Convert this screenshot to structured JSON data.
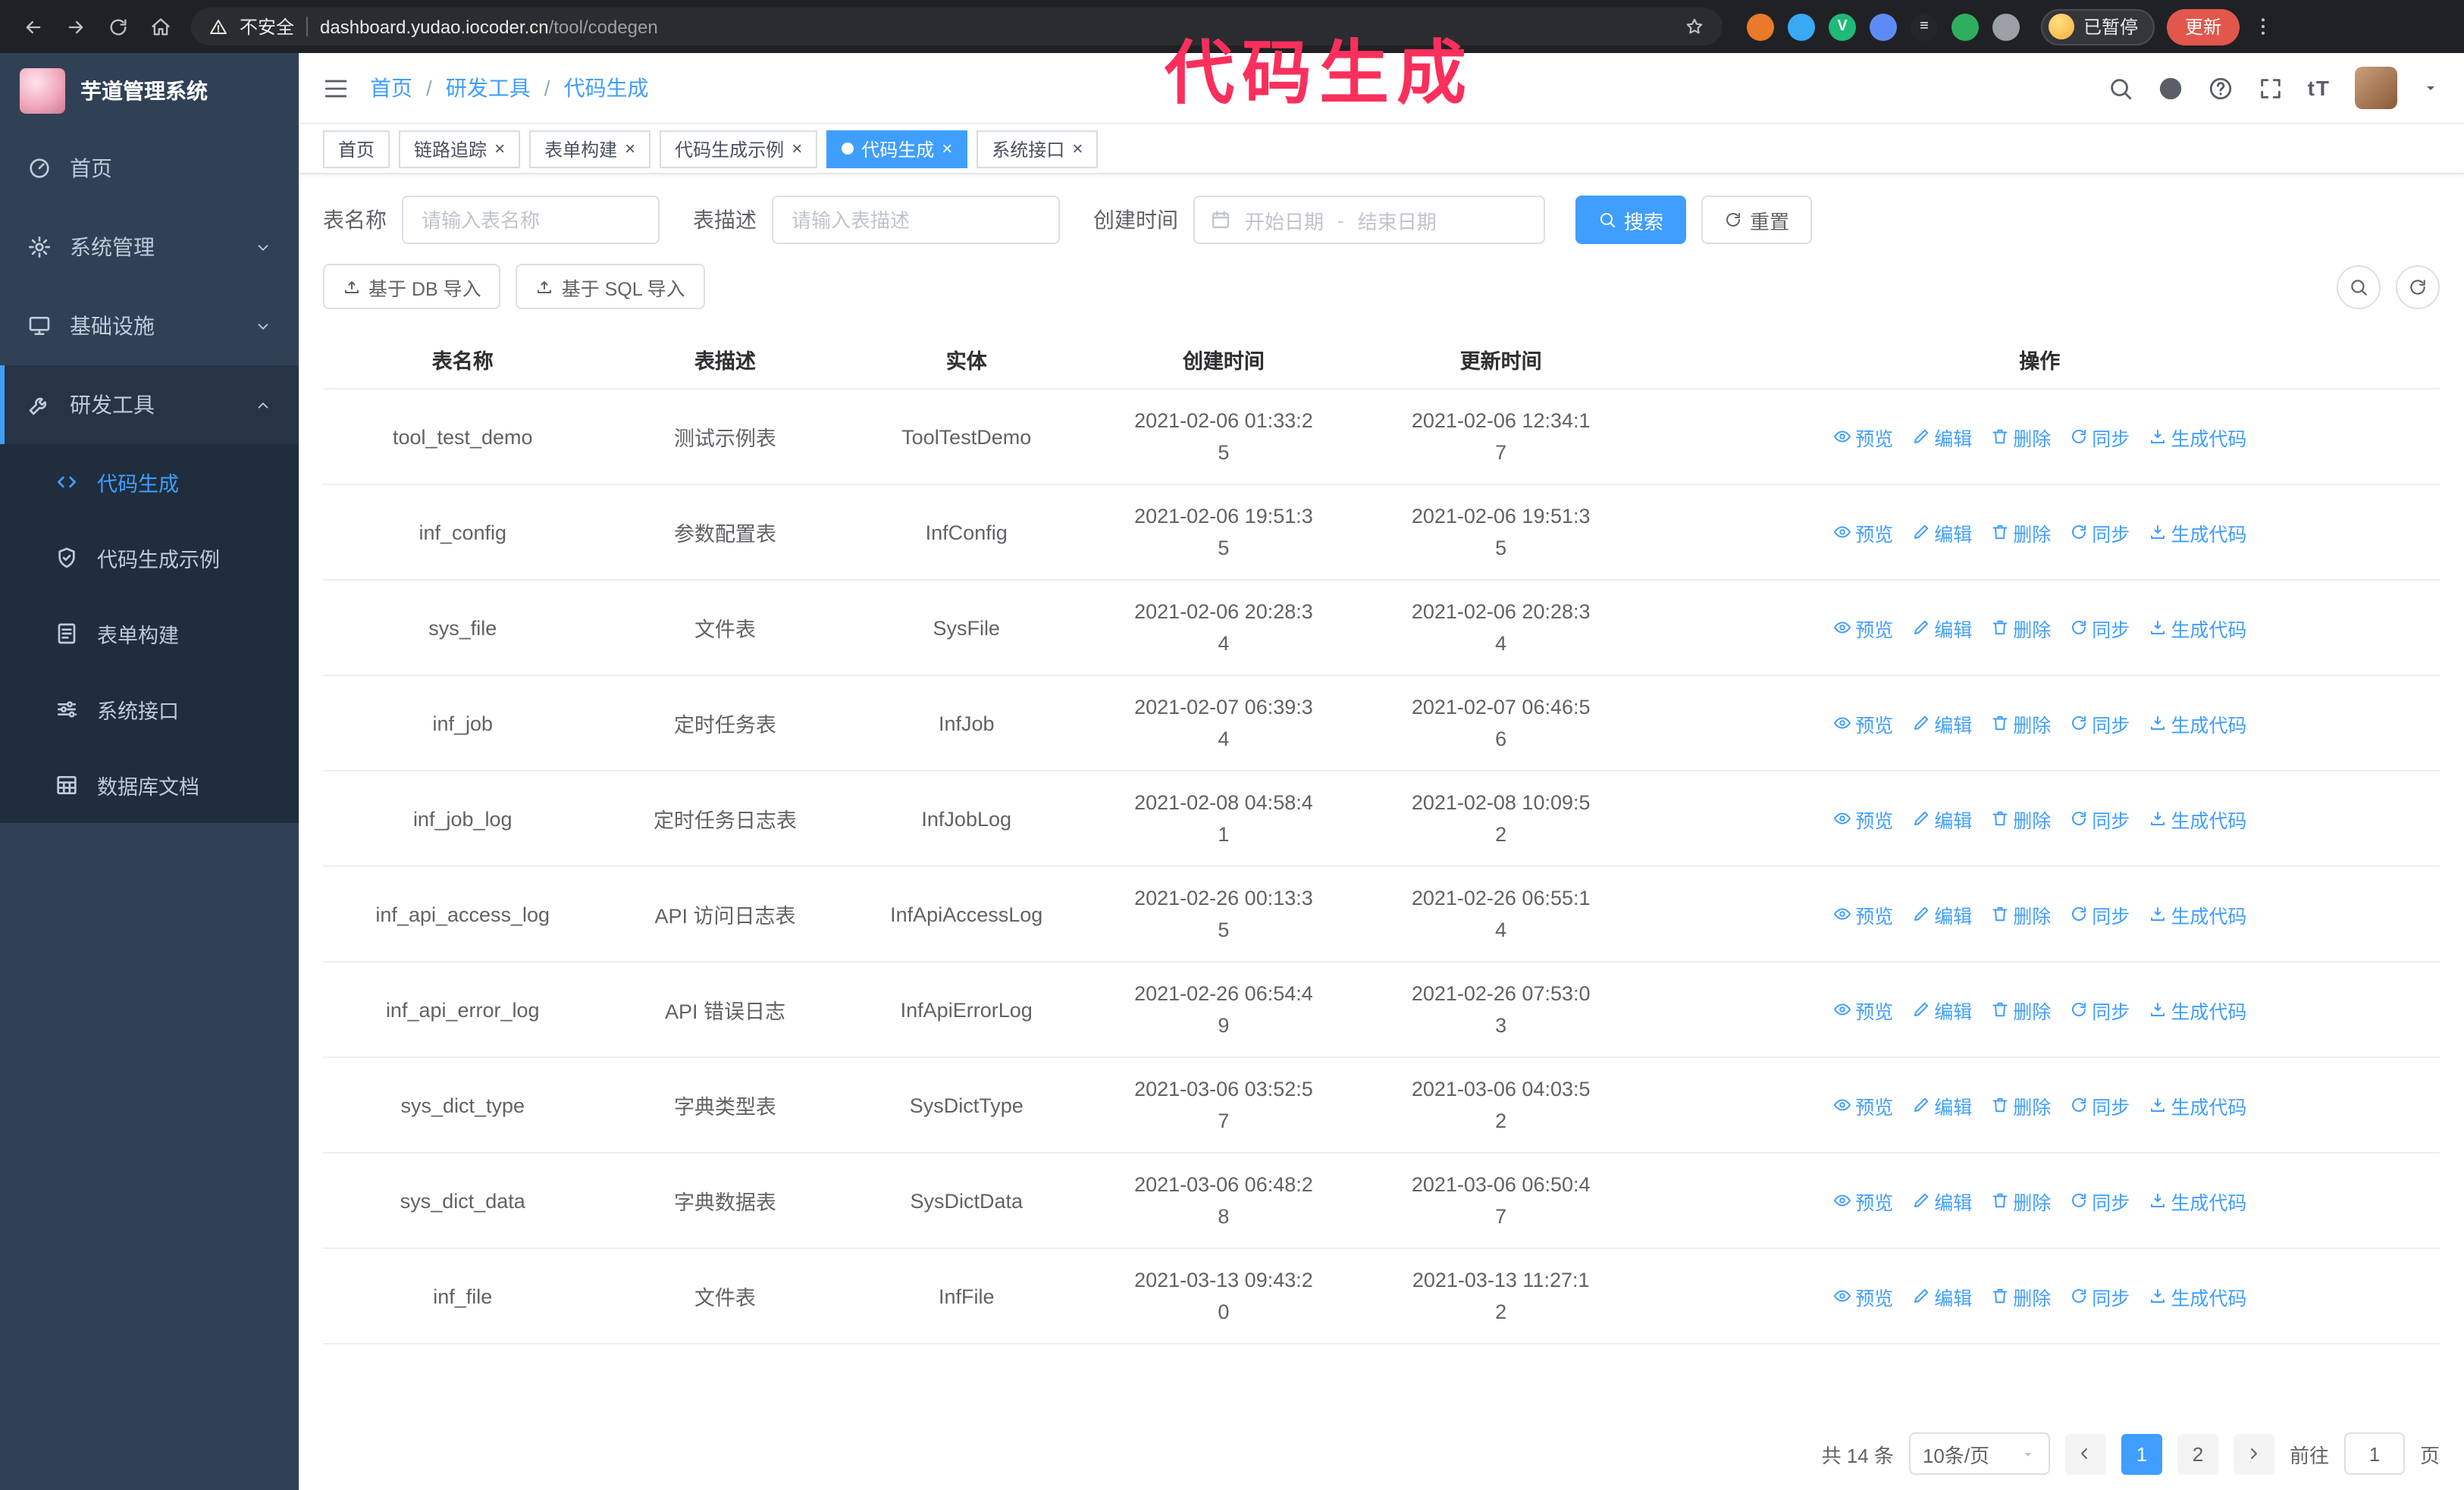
{
  "annotation": "代码生成",
  "colors": {
    "accent": "#409eff",
    "sidebar_bg": "#304156",
    "submenu_bg": "#1f2d3d",
    "annotation_color": "#fb2f5c",
    "update_color": "#e2574c",
    "chrome_bg": "#202124"
  },
  "browser": {
    "nav_icons": [
      "back-icon",
      "forward-icon",
      "reload-icon",
      "home-icon"
    ],
    "security_warning": "不安全",
    "url_host": "dashboard.yudao.iocoder.cn",
    "url_path": "/tool/codegen",
    "bookmark_icon": "star-icon",
    "extensions": [
      {
        "name": "fox-extension-icon",
        "color": "#e87a2a",
        "glyph": ""
      },
      {
        "name": "water-drop-extension-icon",
        "color": "#39a9f4",
        "glyph": ""
      },
      {
        "name": "v-circle-extension-icon",
        "color": "#1fb978",
        "glyph": "V"
      },
      {
        "name": "people-extension-icon",
        "color": "#5c8bf5",
        "glyph": ""
      },
      {
        "name": "dark-extension-icon",
        "color": "#23272b",
        "glyph": "≡"
      },
      {
        "name": "leaf-extension-icon",
        "color": "#2fae5e",
        "glyph": ""
      },
      {
        "name": "puzzle-extension-icon",
        "color": "#9aa0a6",
        "glyph": ""
      }
    ],
    "paused_badge": "已暂停",
    "update_button": "更新",
    "menu_icon": "kebab-icon"
  },
  "sidebar": {
    "title": "芋道管理系统",
    "items": [
      {
        "key": "home",
        "label": "首页",
        "icon": "dashboard-icon",
        "chevron": null,
        "active": false
      },
      {
        "key": "system",
        "label": "系统管理",
        "icon": "gear-icon",
        "chevron": "down",
        "active": false
      },
      {
        "key": "infra",
        "label": "基础设施",
        "icon": "infra-icon",
        "chevron": "down",
        "active": false
      },
      {
        "key": "devtools",
        "label": "研发工具",
        "icon": "tools-icon",
        "chevron": "up",
        "active": true
      }
    ],
    "submenu": [
      {
        "key": "codegen",
        "label": "代码生成",
        "icon": "code-icon",
        "active": true
      },
      {
        "key": "codegen-example",
        "label": "代码生成示例",
        "icon": "shield-icon",
        "active": false
      },
      {
        "key": "form-builder",
        "label": "表单构建",
        "icon": "form-icon",
        "active": false
      },
      {
        "key": "api",
        "label": "系统接口",
        "icon": "sliders-icon",
        "active": false
      },
      {
        "key": "db-doc",
        "label": "数据库文档",
        "icon": "table-grid-icon",
        "active": false
      }
    ]
  },
  "header": {
    "breadcrumb": {
      "items": [
        "首页",
        "研发工具",
        "代码生成"
      ],
      "separator": "/"
    },
    "icons": [
      "search-icon",
      "github-icon",
      "help-icon",
      "fullscreen-icon",
      "font-size-icon"
    ],
    "font_size_icon_text": "tT"
  },
  "tags": [
    {
      "key": "home",
      "label": "首页",
      "closable": false,
      "active": false
    },
    {
      "key": "tracing",
      "label": "链路追踪",
      "closable": true,
      "active": false
    },
    {
      "key": "form-builder",
      "label": "表单构建",
      "closable": true,
      "active": false
    },
    {
      "key": "codegen-example",
      "label": "代码生成示例",
      "closable": true,
      "active": false
    },
    {
      "key": "codegen",
      "label": "代码生成",
      "closable": true,
      "active": true
    },
    {
      "key": "api",
      "label": "系统接口",
      "closable": true,
      "active": false
    }
  ],
  "filters": {
    "table_name_label": "表名称",
    "table_name_placeholder": "请输入表名称",
    "table_desc_label": "表描述",
    "table_desc_placeholder": "请输入表描述",
    "create_time_label": "创建时间",
    "calendar_icon": "calendar-icon",
    "start_date_placeholder": "开始日期",
    "range_separator": "-",
    "end_date_placeholder": "结束日期",
    "search_button": "搜索",
    "reset_button": "重置"
  },
  "toolbar": {
    "import_db": "基于 DB 导入",
    "import_sql": "基于 SQL 导入",
    "icon": "upload-icon",
    "right_icons": [
      "search-icon",
      "refresh-icon"
    ]
  },
  "table": {
    "columns": [
      "表名称",
      "表描述",
      "实体",
      "创建时间",
      "更新时间",
      "操作"
    ],
    "actions": [
      {
        "key": "preview",
        "label": "预览",
        "icon": "eye-icon"
      },
      {
        "key": "edit",
        "label": "编辑",
        "icon": "edit-icon"
      },
      {
        "key": "delete",
        "label": "删除",
        "icon": "delete-icon"
      },
      {
        "key": "sync",
        "label": "同步",
        "icon": "sync-icon"
      },
      {
        "key": "generate",
        "label": "生成代码",
        "icon": "download-icon"
      }
    ],
    "rows": [
      {
        "name": "tool_test_demo",
        "desc": "测试示例表",
        "entity": "ToolTestDemo",
        "created": "2021-02-06 01:33:25",
        "updated": "2021-02-06 12:34:17"
      },
      {
        "name": "inf_config",
        "desc": "参数配置表",
        "entity": "InfConfig",
        "created": "2021-02-06 19:51:35",
        "updated": "2021-02-06 19:51:35"
      },
      {
        "name": "sys_file",
        "desc": "文件表",
        "entity": "SysFile",
        "created": "2021-02-06 20:28:34",
        "updated": "2021-02-06 20:28:34"
      },
      {
        "name": "inf_job",
        "desc": "定时任务表",
        "entity": "InfJob",
        "created": "2021-02-07 06:39:34",
        "updated": "2021-02-07 06:46:56"
      },
      {
        "name": "inf_job_log",
        "desc": "定时任务日志表",
        "entity": "InfJobLog",
        "created": "2021-02-08 04:58:41",
        "updated": "2021-02-08 10:09:52"
      },
      {
        "name": "inf_api_access_log",
        "desc": "API 访问日志表",
        "entity": "InfApiAccessLog",
        "created": "2021-02-26 00:13:35",
        "updated": "2021-02-26 06:55:14"
      },
      {
        "name": "inf_api_error_log",
        "desc": "API 错误日志",
        "entity": "InfApiErrorLog",
        "created": "2021-02-26 06:54:49",
        "updated": "2021-02-26 07:53:03"
      },
      {
        "name": "sys_dict_type",
        "desc": "字典类型表",
        "entity": "SysDictType",
        "created": "2021-03-06 03:52:57",
        "updated": "2021-03-06 04:03:52"
      },
      {
        "name": "sys_dict_data",
        "desc": "字典数据表",
        "entity": "SysDictData",
        "created": "2021-03-06 06:48:28",
        "updated": "2021-03-06 06:50:47"
      },
      {
        "name": "inf_file",
        "desc": "文件表",
        "entity": "InfFile",
        "created": "2021-03-13 09:43:20",
        "updated": "2021-03-13 11:27:12"
      }
    ]
  },
  "pagination": {
    "total_label": "共 14 条",
    "page_size_label": "10条/页",
    "pages": [
      "1",
      "2"
    ],
    "active_page": "1",
    "goto_label": "前往",
    "goto_value": "1",
    "unit_label": "页"
  }
}
